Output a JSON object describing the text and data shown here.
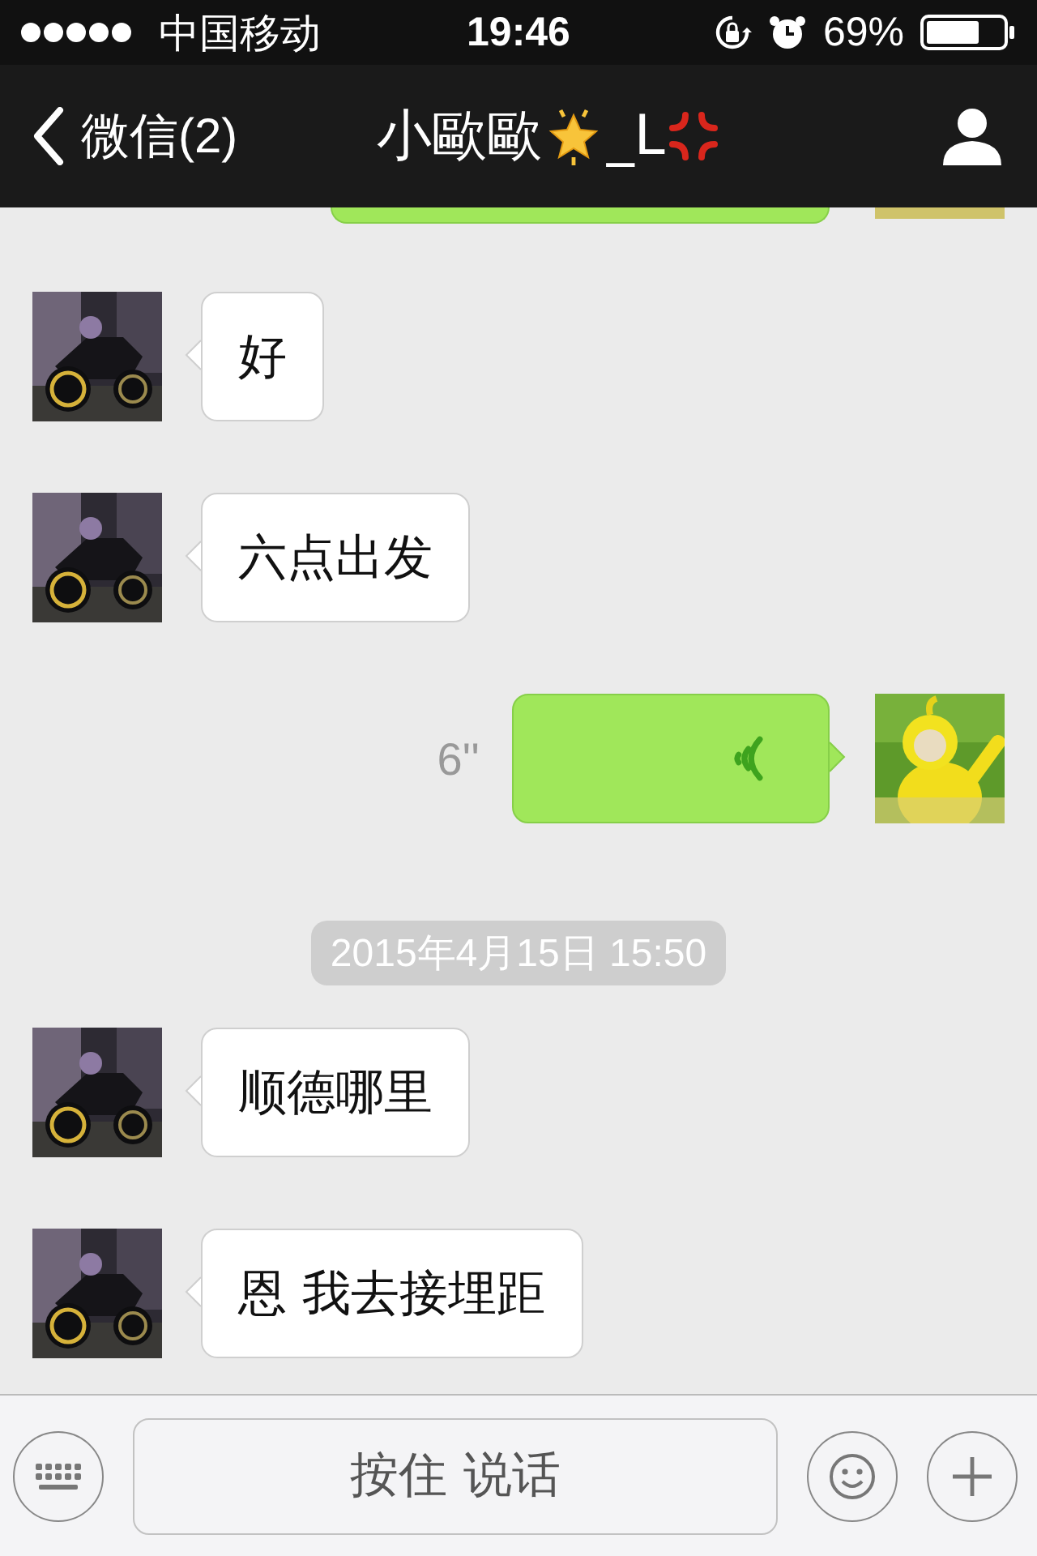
{
  "status_bar": {
    "carrier": "中国移动",
    "time": "19:46",
    "battery": "69%"
  },
  "nav": {
    "back": "微信(2)",
    "title": "小歐歐",
    "title_suffix": "_L"
  },
  "messages": [
    {
      "kind": "voice",
      "outgoing": true,
      "cut_off": true
    },
    {
      "kind": "text",
      "outgoing": false,
      "text": "好"
    },
    {
      "kind": "text",
      "outgoing": false,
      "text": "六点出发"
    },
    {
      "kind": "voice",
      "outgoing": true,
      "duration": "6''"
    },
    {
      "kind": "time",
      "text": "2015年4月15日 15:50"
    },
    {
      "kind": "text",
      "outgoing": false,
      "text": "顺德哪里"
    },
    {
      "kind": "text",
      "outgoing": false,
      "text": "恩  我去接埋距"
    }
  ],
  "input_bar": {
    "hold_to_talk": "按住 说话"
  }
}
